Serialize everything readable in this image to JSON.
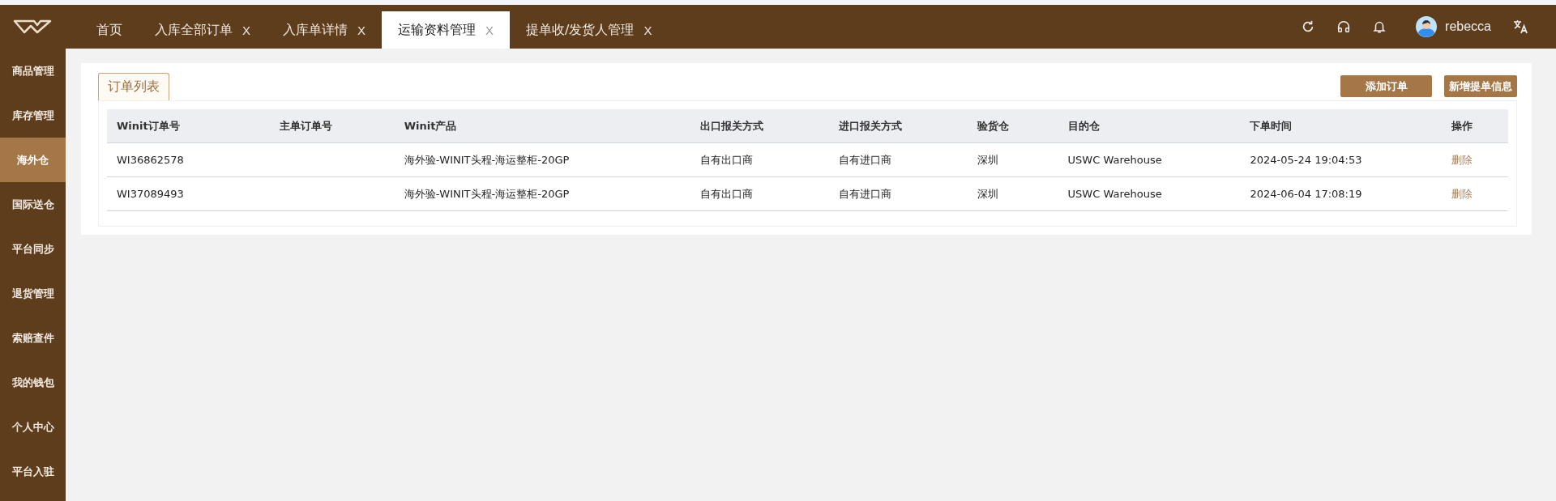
{
  "header": {
    "tabs": [
      {
        "label": "首页",
        "selected": false
      },
      {
        "label": "入库全部订单",
        "selected": false,
        "close": "X"
      },
      {
        "label": "入库单详情",
        "selected": false,
        "close": "X"
      },
      {
        "label": "运输资料管理",
        "selected": true,
        "close": "X"
      },
      {
        "label": "提单收/发货人管理",
        "selected": false,
        "close": "X"
      }
    ],
    "user": {
      "name": "rebecca"
    }
  },
  "sidebar": {
    "items": [
      {
        "label": "商品管理",
        "selected": false
      },
      {
        "label": "库存管理",
        "selected": false
      },
      {
        "label": "海外仓",
        "selected": true
      },
      {
        "label": "国际送仓",
        "selected": false
      },
      {
        "label": "平台同步",
        "selected": false
      },
      {
        "label": "退货管理",
        "selected": false
      },
      {
        "label": "索赔查件",
        "selected": false
      },
      {
        "label": "我的钱包",
        "selected": false
      },
      {
        "label": "个人中心",
        "selected": false
      },
      {
        "label": "平台入驻",
        "selected": false
      }
    ]
  },
  "panel": {
    "tab": "订单列表",
    "buttons": [
      "添加订单",
      "新增提单信息"
    ],
    "table": {
      "columns": [
        "Winit订单号",
        "主单订单号",
        "Winit产品",
        "出口报关方式",
        "进口报关方式",
        "验货仓",
        "目的仓",
        "下单时间",
        "操作"
      ],
      "rows": [
        {
          "cells": [
            "WI36862578",
            "",
            "海外验-WINIT头程-海运整柜-20GP",
            "自有出口商",
            "自有进口商",
            "深圳",
            "USWC Warehouse",
            "2024-05-24 19:04:53"
          ],
          "action": "删除"
        },
        {
          "cells": [
            "WI37089493",
            "",
            "海外验-WINIT头程-海运整柜-20GP",
            "自有出口商",
            "自有进口商",
            "深圳",
            "USWC Warehouse",
            "2024-06-04 17:08:19"
          ],
          "action": "删除"
        }
      ]
    }
  }
}
